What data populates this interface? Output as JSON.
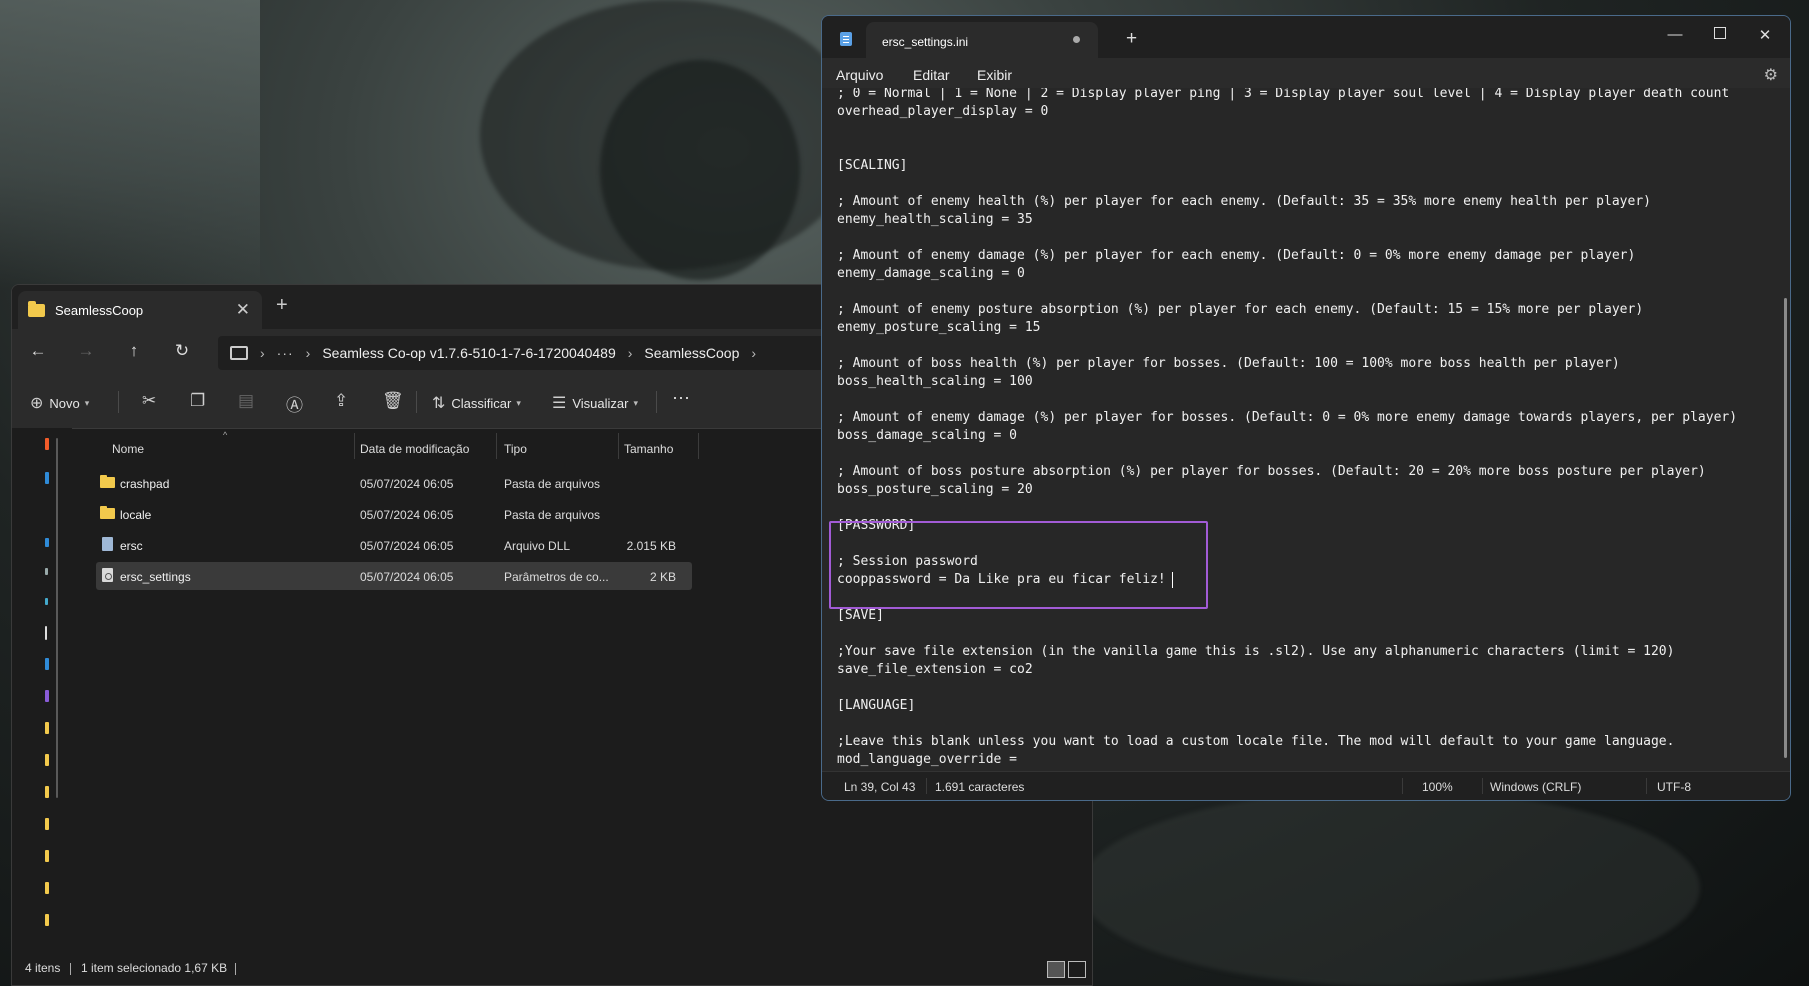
{
  "explorer": {
    "tab_title": "SeamlessCoop",
    "tab_close": "✕",
    "new_tab": "+",
    "breadcrumb": {
      "overflow": "···",
      "path1": "Seamless Co-op v1.7.6-510-1-7-6-1720040489",
      "path2": "SeamlessCoop",
      "sep": "›"
    },
    "commands": {
      "new": "Novo",
      "sort": "Classificar",
      "view": "Visualizar",
      "more": "···"
    },
    "columns": {
      "name": "Nome",
      "modified": "Data de modificação",
      "type": "Tipo",
      "size": "Tamanho"
    },
    "files": [
      {
        "name": "crashpad",
        "modified": "05/07/2024 06:05",
        "type": "Pasta de arquivos",
        "size": ""
      },
      {
        "name": "locale",
        "modified": "05/07/2024 06:05",
        "type": "Pasta de arquivos",
        "size": ""
      },
      {
        "name": "ersc",
        "modified": "05/07/2024 06:05",
        "type": "Arquivo DLL",
        "size": "2.015 KB"
      },
      {
        "name": "ersc_settings",
        "modified": "05/07/2024 06:05",
        "type": "Parâmetros de co...",
        "size": "2 KB"
      }
    ],
    "status": {
      "items": "4 itens",
      "selected": "1 item selecionado  1,67 KB"
    }
  },
  "notepad": {
    "tab_title": "ersc_settings.ini",
    "new_tab": "+",
    "window_controls": {
      "minimize": "—",
      "close": "✕"
    },
    "menu": {
      "file": "Arquivo",
      "edit": "Editar",
      "view": "Exibir"
    },
    "lines": [
      "; 0 = Normal | 1 = None | 2 = Display player ping | 3 = Display player soul level | 4 = Display player death count",
      "overhead_player_display = 0",
      "",
      "",
      "[SCALING]",
      "",
      "; Amount of enemy health (%) per player for each enemy. (Default: 35 = 35% more enemy health per player)",
      "enemy_health_scaling = 35",
      "",
      "; Amount of enemy damage (%) per player for each enemy. (Default: 0 = 0% more enemy damage per player)",
      "enemy_damage_scaling = 0",
      "",
      "; Amount of enemy posture absorption (%) per player for each enemy. (Default: 15 = 15% more per player)",
      "enemy_posture_scaling = 15",
      "",
      "; Amount of boss health (%) per player for bosses. (Default: 100 = 100% more boss health per player)",
      "boss_health_scaling = 100",
      "",
      "; Amount of enemy damage (%) per player for bosses. (Default: 0 = 0% more enemy damage towards players, per player)",
      "boss_damage_scaling = 0",
      "",
      "; Amount of boss posture absorption (%) per player for bosses. (Default: 20 = 20% more boss posture per player)",
      "boss_posture_scaling = 20",
      "",
      "[PASSWORD]",
      "",
      "; Session password",
      "cooppassword = Da Like pra eu ficar feliz!",
      "",
      "[SAVE]",
      "",
      ";Your save file extension (in the vanilla game this is .sl2). Use any alphanumeric characters (limit = 120)",
      "save_file_extension = co2",
      "",
      "[LANGUAGE]",
      "",
      ";Leave this blank unless you want to load a custom locale file. The mod will default to your game language.",
      "mod_language_override ="
    ],
    "status": {
      "position": "Ln 39, Col 43",
      "chars": "1.691 caracteres",
      "zoom": "100%",
      "eol": "Windows (CRLF)",
      "encoding": "UTF-8"
    },
    "highlight_color": "#a25bd6"
  }
}
